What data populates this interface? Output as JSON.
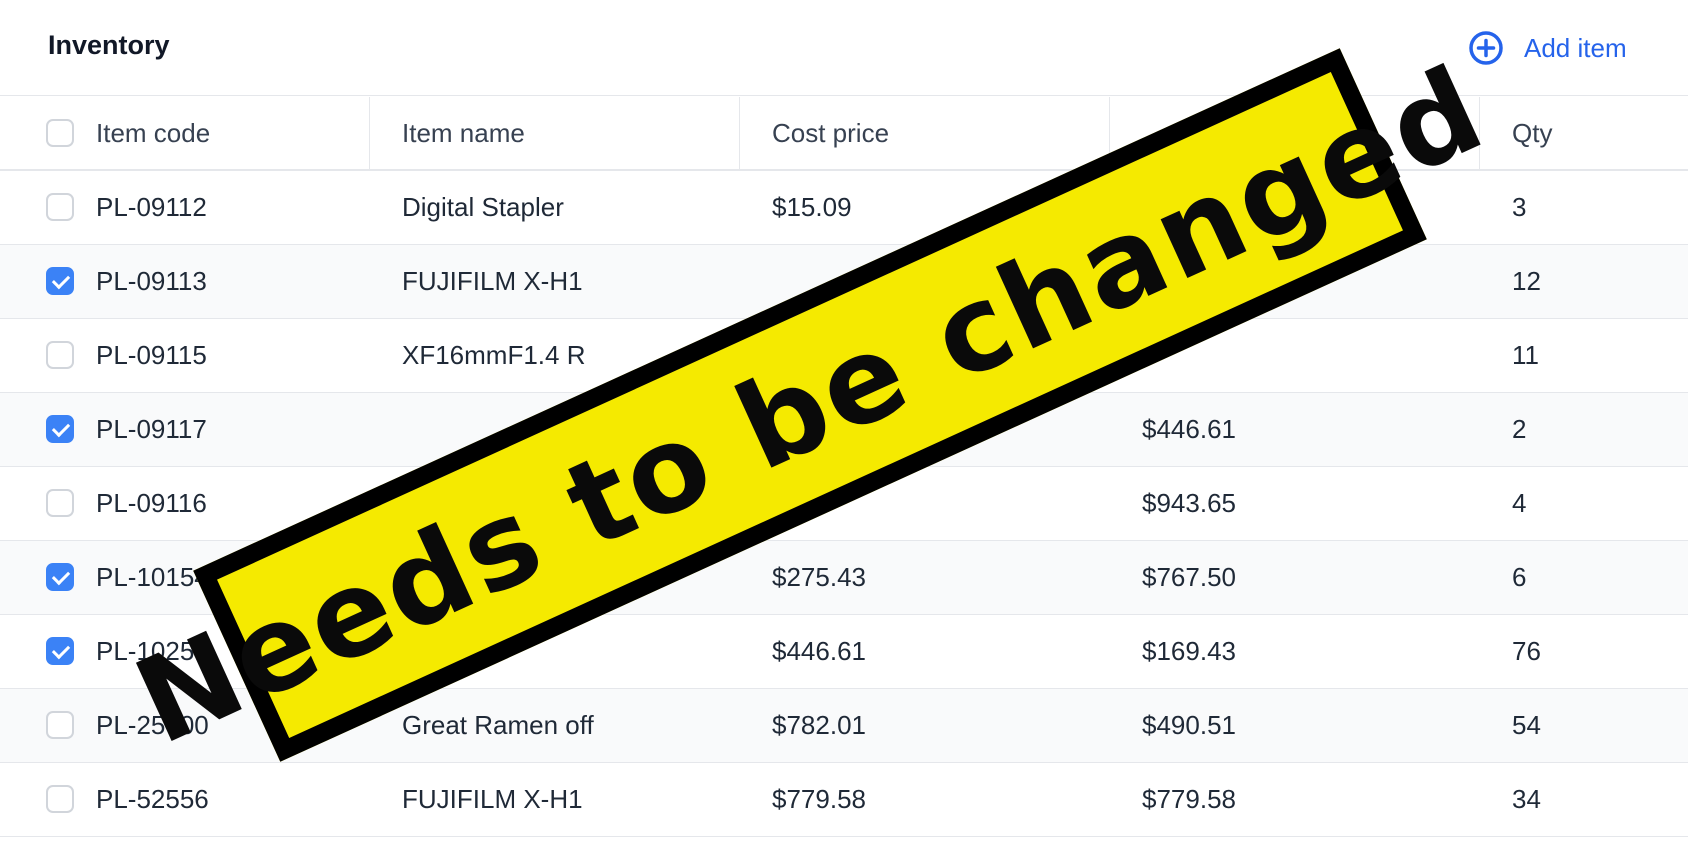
{
  "header": {
    "title": "Inventory",
    "add_label": "Add item",
    "accent": "#2563eb"
  },
  "table": {
    "columns": [
      "Item code",
      "Item name",
      "Cost price",
      "",
      "Qty"
    ],
    "rows": [
      {
        "checked": false,
        "code": "PL-09112",
        "name": "Digital Stapler",
        "cost": "$15.09",
        "sell": "",
        "qty": "3"
      },
      {
        "checked": true,
        "code": "PL-09113",
        "name": "FUJIFILM X-H1",
        "cost": "",
        "sell": "",
        "qty": "12"
      },
      {
        "checked": false,
        "code": "PL-09115",
        "name": "XF16mmF1.4 R",
        "cost": "",
        "sell": "",
        "qty": "11"
      },
      {
        "checked": true,
        "code": "PL-09117",
        "name": "",
        "cost": "",
        "sell": "$446.61",
        "qty": "2"
      },
      {
        "checked": false,
        "code": "PL-09116",
        "name": "",
        "cost": "",
        "sell": "$943.65",
        "qty": "4"
      },
      {
        "checked": true,
        "code": "PL-10154",
        "name": "",
        "cost": "$275.43",
        "sell": "$767.50",
        "qty": "6"
      },
      {
        "checked": true,
        "code": "PL-10255",
        "name": "",
        "cost": "$446.61",
        "sell": "$169.43",
        "qty": "76"
      },
      {
        "checked": false,
        "code": "PL-25000",
        "name": "Great Ramen off",
        "cost": "$782.01",
        "sell": "$490.51",
        "qty": "54"
      },
      {
        "checked": false,
        "code": "PL-52556",
        "name": "FUJIFILM X-H1",
        "cost": "$779.58",
        "sell": "$779.58",
        "qty": "34"
      }
    ]
  },
  "overlay": {
    "text": "Needs to be changed",
    "background": "#f5ea00",
    "border": "#000000"
  }
}
